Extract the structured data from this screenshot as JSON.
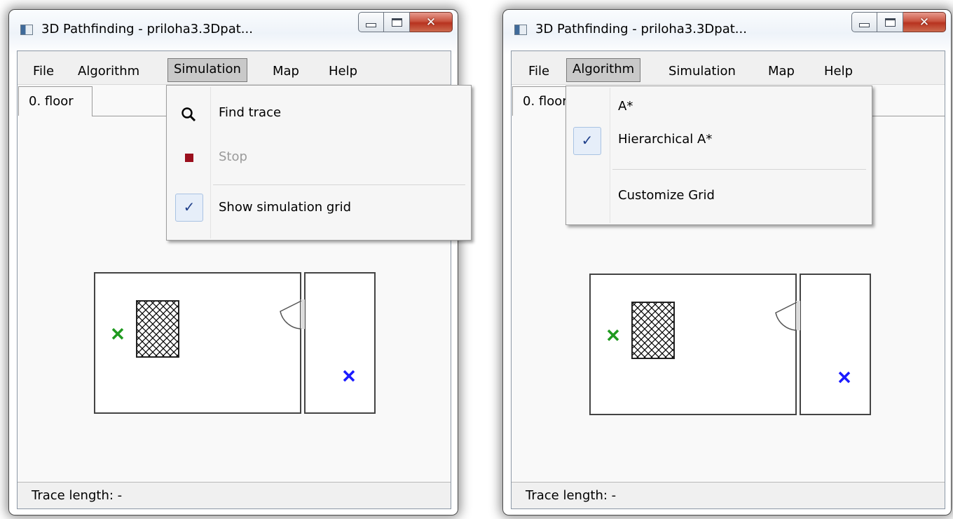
{
  "windows": [
    {
      "title": "3D Pathfinding - priloha3.3Dpat...",
      "menu": [
        "File",
        "Algorithm",
        "Simulation",
        "Map",
        "Help"
      ],
      "open_menu_index": 2,
      "tab_label": "0. floor",
      "status_text": "Trace length: -",
      "dropdown": {
        "items": [
          {
            "label": "Find trace",
            "icon": "search-icon",
            "enabled": true,
            "checked": false
          },
          {
            "label": "Stop",
            "icon": "stop-icon",
            "enabled": false,
            "checked": false
          },
          {
            "separator": true
          },
          {
            "label": "Show simulation grid",
            "icon": "",
            "enabled": true,
            "checked": true
          }
        ]
      }
    },
    {
      "title": "3D Pathfinding - priloha3.3Dpat...",
      "menu": [
        "File",
        "Algorithm",
        "Simulation",
        "Map",
        "Help"
      ],
      "open_menu_index": 1,
      "tab_label": "0. floor",
      "status_text": "Trace length: -",
      "dropdown": {
        "items": [
          {
            "label": "A*",
            "icon": "",
            "enabled": true,
            "checked": false
          },
          {
            "label": "Hierarchical A*",
            "icon": "",
            "enabled": true,
            "checked": true
          },
          {
            "separator": true
          },
          {
            "label": "Customize Grid",
            "icon": "",
            "enabled": true,
            "checked": false
          }
        ]
      }
    }
  ],
  "caption_buttons": {
    "minimize": "minimize-icon",
    "maximize": "maximize-icon",
    "close": "close-icon"
  },
  "map_markers": {
    "start_color": "#1f9a1f",
    "goal_color": "#1a1aff"
  },
  "colors": {
    "stop_icon": "#9b0f1d",
    "check": "#1f3f8a"
  }
}
